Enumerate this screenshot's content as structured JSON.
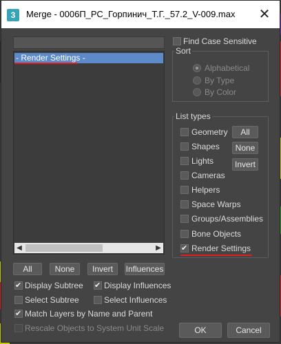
{
  "window": {
    "title": "Merge - 0006П_РС_Горпинич_Т.Г._57.2_V-009.max",
    "icon_label": "3",
    "close_glyph": "✕"
  },
  "filter": {
    "value": "",
    "placeholder": ""
  },
  "list": {
    "items": [
      "- Render Settings -"
    ],
    "scroll_left": "◀",
    "scroll_right": "▶"
  },
  "list_buttons": {
    "all": "All",
    "none": "None",
    "invert": "Invert",
    "influences": "Influences"
  },
  "options": {
    "display_subtree": {
      "label": "Display Subtree",
      "checked": true
    },
    "display_influences": {
      "label": "Display Influences",
      "checked": true
    },
    "select_subtree": {
      "label": "Select Subtree",
      "checked": false
    },
    "select_influences": {
      "label": "Select Influences",
      "checked": false
    },
    "match_layers": {
      "label": "Match Layers by Name and Parent",
      "checked": true
    },
    "rescale": {
      "label": "Rescale Objects to System Unit Scale",
      "checked": false,
      "disabled": true
    }
  },
  "find_case_sensitive": {
    "label": "Find Case Sensitive",
    "checked": false
  },
  "sort": {
    "title": "Sort",
    "options": [
      "Alphabetical",
      "By Type",
      "By Color"
    ],
    "selected": "Alphabetical"
  },
  "list_types": {
    "title": "List types",
    "items": [
      {
        "label": "Geometry",
        "checked": false
      },
      {
        "label": "Shapes",
        "checked": false
      },
      {
        "label": "Lights",
        "checked": false
      },
      {
        "label": "Cameras",
        "checked": false
      },
      {
        "label": "Helpers",
        "checked": false
      },
      {
        "label": "Space Warps",
        "checked": false
      },
      {
        "label": "Groups/Assemblies",
        "checked": false
      },
      {
        "label": "Bone Objects",
        "checked": false
      },
      {
        "label": "Render Settings",
        "checked": true
      }
    ],
    "all_button": "All",
    "none_button": "None",
    "invert_button": "Invert"
  },
  "footer": {
    "ok": "OK",
    "cancel": "Cancel"
  },
  "colors": {
    "dialog_bg": "#444444",
    "selection": "#5d8ac9",
    "annotation_red": "#e02020"
  }
}
